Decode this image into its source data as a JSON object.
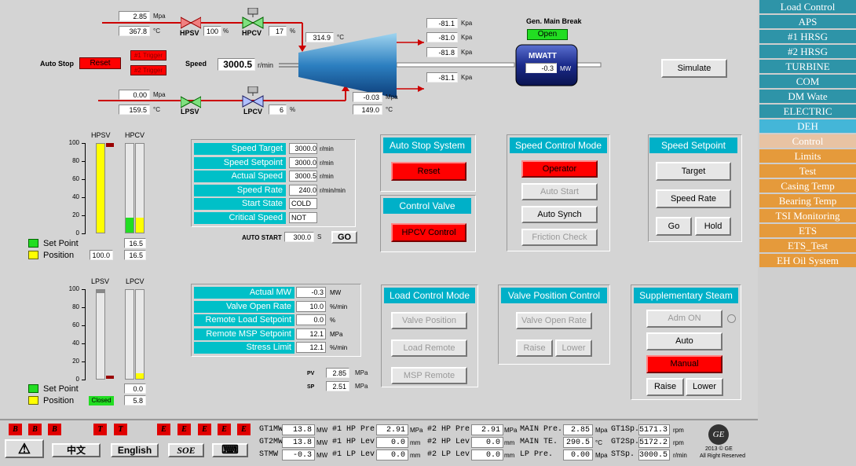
{
  "sidebar": {
    "items": [
      {
        "label": "Load Control",
        "style": "teal"
      },
      {
        "label": "APS",
        "style": "teal"
      },
      {
        "label": "#1 HRSG",
        "style": "teal"
      },
      {
        "label": "#2 HRSG",
        "style": "teal"
      },
      {
        "label": "TURBINE",
        "style": "teal"
      },
      {
        "label": "COM",
        "style": "teal"
      },
      {
        "label": "DM Wate",
        "style": "teal"
      },
      {
        "label": "ELECTRIC",
        "style": "teal"
      },
      {
        "label": "DEH",
        "style": "lt"
      },
      {
        "label": "Control",
        "style": "pale"
      },
      {
        "label": "Limits",
        "style": "or"
      },
      {
        "label": "Test",
        "style": "or"
      },
      {
        "label": "Casing Temp",
        "style": "or"
      },
      {
        "label": "Bearing Temp",
        "style": "or"
      },
      {
        "label": "TSI Monitoring",
        "style": "or"
      },
      {
        "label": "ETS",
        "style": "or"
      },
      {
        "label": "ETS_Test",
        "style": "or"
      },
      {
        "label": "EH Oil System",
        "style": "or"
      }
    ]
  },
  "hp": {
    "pressure": "2.85",
    "p_unit": "Mpa",
    "temp": "367.8",
    "t_unit": "°C",
    "hpsv_label": "HPSV",
    "hpsv_pct": "100",
    "pct": "%",
    "hpcv_label": "HPCV",
    "hpcv_pct": "17"
  },
  "lp": {
    "pressure": "0.00",
    "p_unit": "Mpa",
    "temp": "159.5",
    "t_unit": "°C",
    "lpsv_label": "LPSV",
    "lpcv_label": "LPCV",
    "lpcv_pct": "6"
  },
  "turbine": {
    "inlet_temp": "314.9",
    "mid_p": "-0.03",
    "mid_p_unit": "Mpa",
    "mid_t": "149.0",
    "mid_t_unit": "°C",
    "speed_label": "Speed",
    "speed": "3000.5",
    "speed_unit": "r/min",
    "kpa1": "-81.1",
    "kpa2": "-81.0",
    "kpa3": "-81.8",
    "kpa4": "-81.1",
    "kpa_unit": "Kpa"
  },
  "generator": {
    "breaker_label": "Gen. Main Break",
    "breaker_state": "Open",
    "mwatt_label": "MWATT",
    "mw": "-0.3",
    "mw_unit": "MW"
  },
  "autostop": {
    "label": "Auto Stop",
    "reset": "Reset",
    "trigger1": "#1 Trigger",
    "trigger2": "#2 Trigger"
  },
  "simulate": "Simulate",
  "hp_bars": {
    "title1": "HPSV",
    "title2": "HPCV",
    "ticks": [
      "100",
      "80",
      "60",
      "40",
      "20",
      "0"
    ],
    "sv_pct": 100,
    "cv_pct": 17,
    "sp_label": "Set Point",
    "pos_label": "Position",
    "sp_value": "16.5",
    "pos_sv": "100.0",
    "pos_cv": "16.5"
  },
  "lp_bars": {
    "title1": "LPSV",
    "title2": "LPCV",
    "ticks": [
      "100",
      "80",
      "60",
      "40",
      "20",
      "0"
    ],
    "sv_pct": 0,
    "cv_pct": 6,
    "sp_label": "Set Point",
    "pos_label": "Position",
    "sp_value": "0.0",
    "closed": "Closed",
    "pos_cv": "5.8"
  },
  "speed_table": {
    "rows": [
      {
        "label": "Speed Target",
        "value": "3000.0",
        "unit": "r/min"
      },
      {
        "label": "Speed Setpoint",
        "value": "3000.0",
        "unit": "r/min"
      },
      {
        "label": "Actual Speed",
        "value": "3000.5",
        "unit": "r/min"
      },
      {
        "label": "Speed Rate",
        "value": "240.0",
        "unit": "r/min/min"
      },
      {
        "label": "Start State",
        "value": "COLD",
        "unit": ""
      },
      {
        "label": "Critical Speed",
        "value": "NOT",
        "unit": ""
      }
    ],
    "auto_start_label": "AUTO START",
    "auto_start_value": "300.0",
    "auto_start_unit": "S",
    "go": "GO"
  },
  "auto_stop_system": {
    "title": "Auto Stop System",
    "reset": "Reset"
  },
  "control_valve": {
    "title": "Control Valve",
    "button": "HPCV Control"
  },
  "speed_control_mode": {
    "title": "Speed Control Mode",
    "operator": "Operator",
    "auto_start": "Auto Start",
    "auto_synch": "Auto Synch",
    "friction": "Friction Check"
  },
  "speed_setpoint": {
    "title": "Speed Setpoint",
    "target": "Target",
    "rate": "Speed Rate",
    "go": "Go",
    "hold": "Hold"
  },
  "load_table": {
    "rows": [
      {
        "label": "Actual MW",
        "value": "-0.3",
        "unit": "MW"
      },
      {
        "label": "Valve Open Rate",
        "value": "10.0",
        "unit": "%/min"
      },
      {
        "label": "Remote Load Setpoint",
        "value": "0.0",
        "unit": "%"
      },
      {
        "label": "Remote MSP Setpoint",
        "value": "12.1",
        "unit": "MPa"
      },
      {
        "label": "Stress Limit",
        "value": "12.1",
        "unit": "%/min"
      }
    ],
    "pv_label": "PV",
    "pv": "2.85",
    "pv_unit": "MPa",
    "sp_label": "SP",
    "sp": "2.51",
    "sp_unit": "MPa"
  },
  "load_control_mode": {
    "title": "Load Control Mode",
    "b1": "Valve Position",
    "b2": "Load Remote",
    "b3": "MSP Remote"
  },
  "valve_position_control": {
    "title": "Valve Position Control",
    "b1": "Valve Open Rate",
    "raise": "Raise",
    "lower": "Lower"
  },
  "supplementary": {
    "title": "Supplementary Steam",
    "adm": "Adm ON",
    "auto": "Auto",
    "manual": "Manual",
    "raise": "Raise",
    "lower": "Lower"
  },
  "bottom": {
    "alarms": [
      "B",
      "B",
      "B",
      "T",
      "T",
      "E",
      "E",
      "E",
      "E",
      "E"
    ],
    "warn": "⚠",
    "chinese": "中文",
    "english": "English",
    "soe": "SOE",
    "keyboard": "⌨",
    "c1": [
      {
        "label": "GT1MW",
        "value": "13.8",
        "unit": "MW"
      },
      {
        "label": "GT2MW",
        "value": "13.8",
        "unit": "MW"
      },
      {
        "label": "STMW",
        "value": "-0.3",
        "unit": "MW"
      }
    ],
    "c2": [
      {
        "label": "#1 HP Pre.",
        "value": "2.91",
        "unit": "MPa"
      },
      {
        "label": "#1 HP Lev.",
        "value": "0.0",
        "unit": "mm"
      },
      {
        "label": "#1 LP Lev.",
        "value": "0.0",
        "unit": "mm"
      }
    ],
    "c3": [
      {
        "label": "#2 HP Pre.",
        "value": "2.91",
        "unit": "MPa"
      },
      {
        "label": "#2 HP Lev.",
        "value": "0.0",
        "unit": "mm"
      },
      {
        "label": "#2 LP Lev.",
        "value": "0.0",
        "unit": "mm"
      }
    ],
    "c4": [
      {
        "label": "MAIN Pre.",
        "value": "2.85",
        "unit": "Mpa"
      },
      {
        "label": "MAIN TE.",
        "value": "290.5",
        "unit": "°C"
      },
      {
        "label": "LP Pre.",
        "value": "0.00",
        "unit": "Mpa"
      }
    ],
    "c5": [
      {
        "label": "GT1Sp.",
        "value": "5171.3",
        "unit": "rpm"
      },
      {
        "label": "GT2Sp.",
        "value": "5172.2",
        "unit": "rpm"
      },
      {
        "label": "STSp.",
        "value": "3000.5",
        "unit": "r/min"
      }
    ],
    "logo": "GE",
    "copyright": "2013 © GE",
    "rights": "All Right Reserved"
  }
}
